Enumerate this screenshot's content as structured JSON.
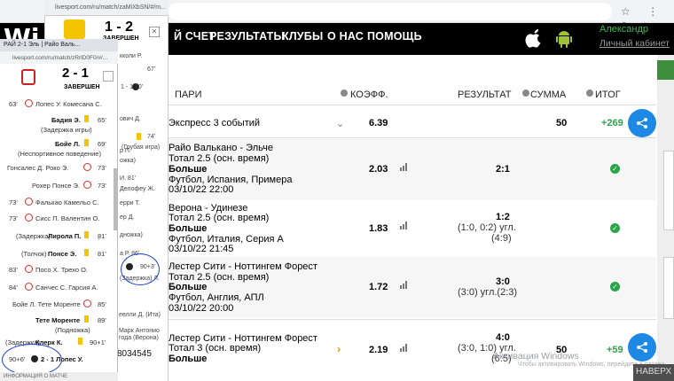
{
  "browser": {
    "url_main": "",
    "tab_left": "РАЙ 2-1 Эль | Райо Валь...",
    "url_left": "livesport.com/ru/match/zRrlD0F0/#/...",
    "url_mid": "livesport.com/ru/match/zaMiXbSN/#/m..."
  },
  "nav": {
    "logo": "Wi",
    "items": [
      "Й СЧЕТ",
      "РЕЗУЛЬТАТЫ",
      "КЛУБЫ",
      "О НАС",
      "ПОМОЩЬ"
    ],
    "user": "Александр",
    "cabinet": "Личный кабинет"
  },
  "table": {
    "headers": {
      "bet": "ПАРИ",
      "odds": "КОЭФФ.",
      "result": "РЕЗУЛЬТАТ",
      "sum": "СУММА",
      "total": "ИТОГ"
    },
    "express": {
      "label": "Экспресс 3 событий",
      "odds": "6.39",
      "sum": "50",
      "total": "+269"
    },
    "rows": [
      {
        "match": "Райо Валькано - Эльче",
        "market": "Тотал 2.5 (осн. время)",
        "pick": "Больше",
        "league": "Футбол, Испания, Примера",
        "date": "03/10/22 22:00",
        "odds": "2.03",
        "result": "2:1",
        "result2": "",
        "result3": ""
      },
      {
        "match": "Верона - Удинезе",
        "market": "Тотал 2.5 (осн. время)",
        "pick": "Больше",
        "league": "Футбол, Италия, Серия А",
        "date": "03/10/22 21:45",
        "odds": "1.83",
        "result": "1:2",
        "result2": "(1:0, 0:2) угл.",
        "result3": "(4:9)"
      },
      {
        "match": "Лестер Сити - Ноттингем Форест",
        "market": "Тотал 2.5 (осн. время)",
        "pick": "Больше",
        "league": "Футбол, Англия, АПЛ",
        "date": "03/10/22 20:00",
        "odds": "1.72",
        "result": "3:0",
        "result2": "(3:0) угл.(2:3)",
        "result3": ""
      }
    ],
    "single": {
      "match": "Лестер Сити - Ноттингем Форест",
      "market": "Тотал 3 (осн. время)",
      "pick": "Больше",
      "odds": "2.19",
      "result": "4:0",
      "result2": "(3:0, 1:0) угл.",
      "result3": "(6:5)",
      "sum": "50",
      "total": "+59"
    }
  },
  "windows": {
    "activate_title": "Активация Windows",
    "activate_sub": "Чтобы активировать Windows, перейдите в раздел",
    "naverh": "НАВЕРХ"
  },
  "mid": {
    "score": "1 - 2",
    "status": "ЗАВЕРШЕН",
    "events": [
      {
        "text": "кколи Р."
      },
      {
        "text": "67'"
      },
      {
        "text": "1 - 1  70'"
      },
      {
        "text": "ович Д."
      },
      {
        "text": "74'"
      },
      {
        "text": "(Грубая игра)"
      },
      {
        "text": "р П."
      },
      {
        "text": "ожка)"
      },
      {
        "text": "И.  81'"
      },
      {
        "text": "Делофеу Ж."
      },
      {
        "text": "ерри Т."
      },
      {
        "text": "ер Д."
      },
      {
        "text": "дножка)"
      },
      {
        "text": "а Р.  86'"
      },
      {
        "text": "90+3'"
      },
      {
        "text": "(Задержка) Л."
      },
      {
        "text": "еелли Д. (Ита)"
      },
      {
        "text": "Марк Антонио"
      },
      {
        "text": "года (Верона)"
      },
      {
        "text": "8034545"
      }
    ]
  },
  "left": {
    "score": "2 - 1",
    "status": "ЗАВЕРШЕН",
    "events": [
      {
        "minute": "63'",
        "text": "Лопес У.  Комесана С."
      },
      {
        "name": "Бадия Э.",
        "minute": "65'",
        "note": "(Задержка игры)"
      },
      {
        "name": "Бойе Л.",
        "minute": "69'",
        "note": "(Неспортивное поведение)"
      },
      {
        "text": "Гонсалес Д.  Роко Э.",
        "minute": "73'"
      },
      {
        "text": "Рохер  Понсе Э.",
        "minute": "73'"
      },
      {
        "minute": "73'",
        "text": "Фалькао  Камельо С."
      },
      {
        "minute": "73'",
        "text": "Сисс П.  Валентин О."
      },
      {
        "note": "(Задержка)",
        "name": "Лирола П.",
        "minute": "81'"
      },
      {
        "note": "(Толчок)",
        "name": "Понсе Э.",
        "minute": "81'"
      },
      {
        "minute": "83'",
        "text": "Посо Х.  Трехо О."
      },
      {
        "minute": "84'",
        "text": "Санчес С.  Гарсия А."
      },
      {
        "text": "Бойе Л.  Тете Моренте",
        "minute": "85'"
      },
      {
        "name": "Тете Моренте",
        "minute": "89'",
        "note": "(Подножка)"
      },
      {
        "note": "(Задержка)",
        "name": "Клерк К.",
        "minute": "90+1'"
      },
      {
        "minute": "90+6'",
        "text": "2 - 1  Лопес У."
      },
      {
        "text": "ИНФОРМАЦИЯ О МАТЧЕ"
      }
    ]
  }
}
